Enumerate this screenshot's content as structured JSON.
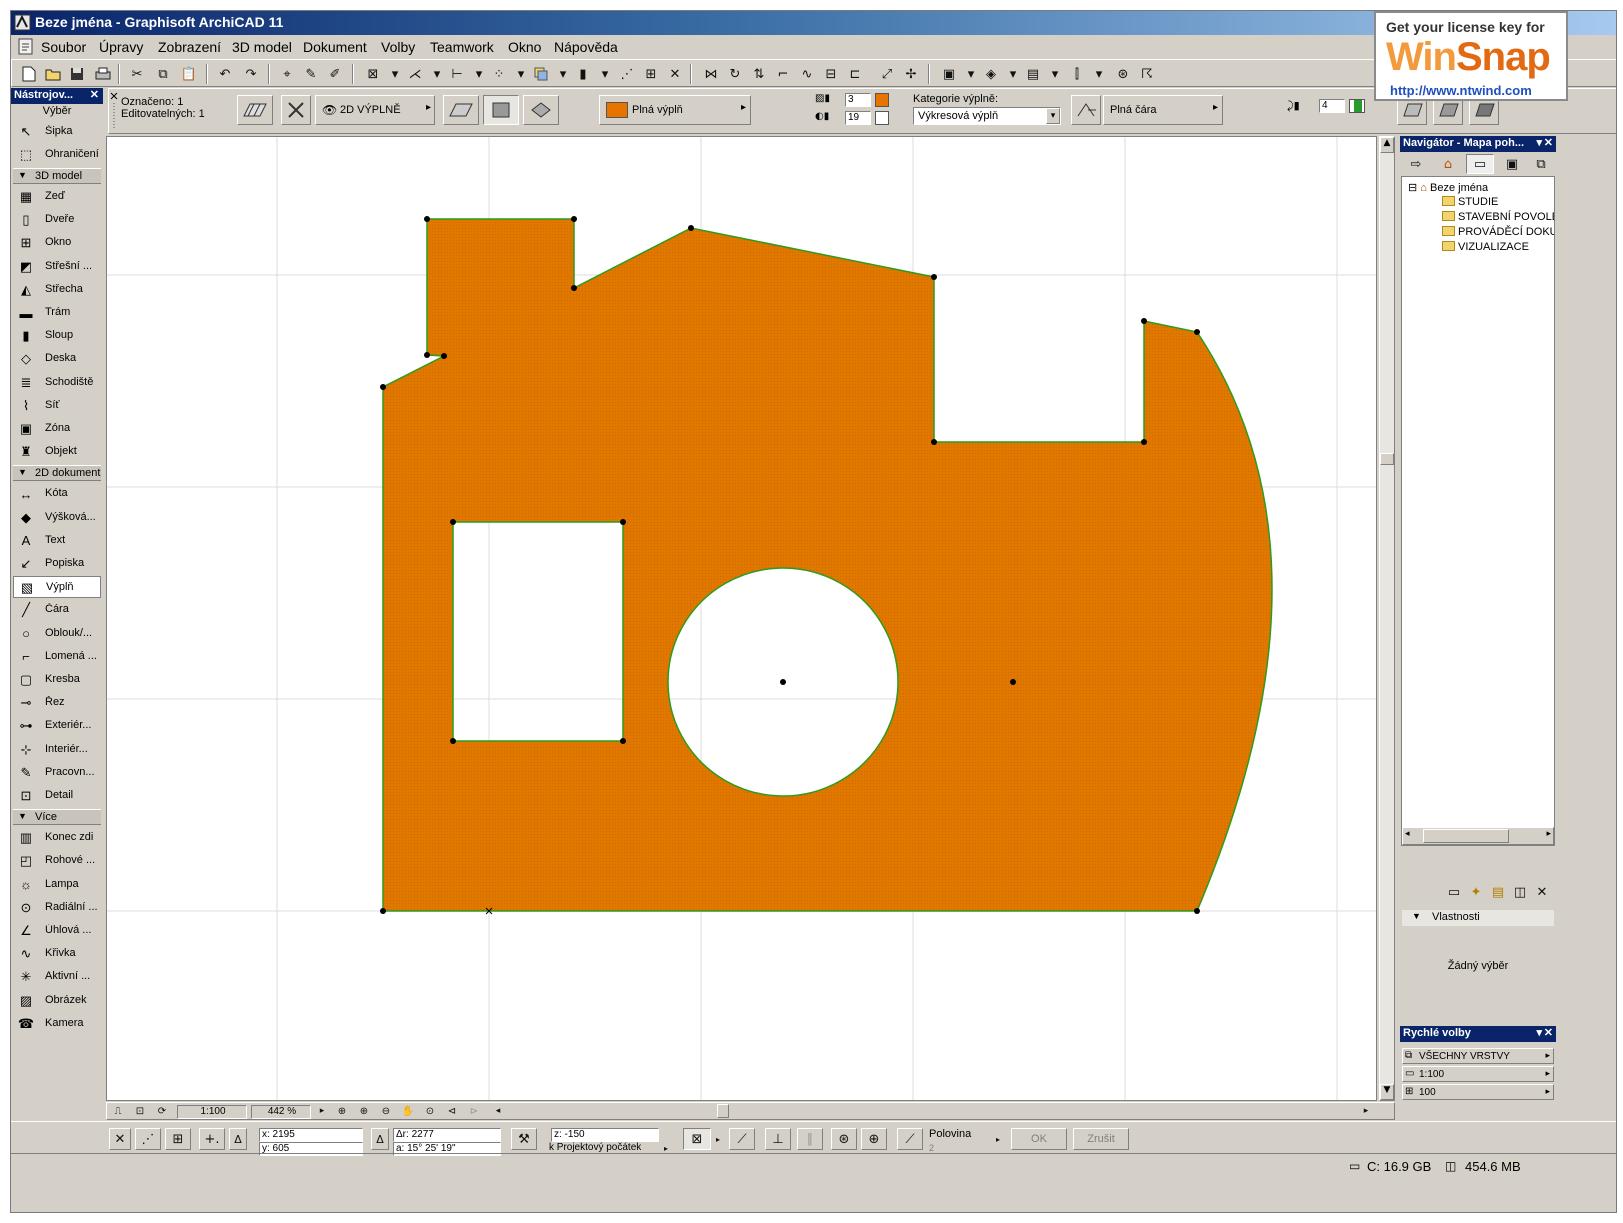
{
  "window": {
    "title": "Beze jména - Graphisoft ArchiCAD 11"
  },
  "ad": {
    "line1": "Get your license key for",
    "brand_a": "Win",
    "brand_b": "Snap",
    "url": "http://www.ntwind.com"
  },
  "menu": [
    "Soubor",
    "Úpravy",
    "Zobrazení",
    "3D model",
    "Dokument",
    "Volby",
    "Teamwork",
    "Okno",
    "Nápověda"
  ],
  "infobox": {
    "selected": "Označeno: 1",
    "editable": "Editovatelných: 1",
    "mode": "2D VÝPLNĚ",
    "fill_name": "Plná výplň",
    "pen1": "3",
    "pen2": "19",
    "category_label": "Kategorie výplně:",
    "category_value": "Výkresová výplň",
    "line_type": "Plná čára",
    "pen_right": "4",
    "fill_color": "#e87400"
  },
  "toolbox": {
    "title": "Nástrojov...",
    "select_group": "Výběr",
    "groups": {
      "model": "3D model",
      "document": "2D dokument",
      "more": "Více"
    },
    "select_tools": [
      {
        "label": "Šipka",
        "icon": "arrow-icon"
      },
      {
        "label": "Ohraničení",
        "icon": "marquee-icon"
      }
    ],
    "model_tools": [
      {
        "label": "Zeď",
        "icon": "wall-icon"
      },
      {
        "label": "Dveře",
        "icon": "door-icon"
      },
      {
        "label": "Okno",
        "icon": "window-icon"
      },
      {
        "label": "Střešní ...",
        "icon": "roof-window-icon"
      },
      {
        "label": "Střecha",
        "icon": "roof-icon"
      },
      {
        "label": "Trám",
        "icon": "beam-icon"
      },
      {
        "label": "Sloup",
        "icon": "column-icon"
      },
      {
        "label": "Deska",
        "icon": "slab-icon"
      },
      {
        "label": "Schodiště",
        "icon": "stair-icon"
      },
      {
        "label": "Síť",
        "icon": "mesh-icon"
      },
      {
        "label": "Zóna",
        "icon": "zone-icon"
      },
      {
        "label": "Objekt",
        "icon": "object-icon"
      }
    ],
    "document_tools": [
      {
        "label": "Kóta",
        "icon": "dimension-icon"
      },
      {
        "label": "Výšková...",
        "icon": "level-dimension-icon"
      },
      {
        "label": "Text",
        "icon": "text-icon"
      },
      {
        "label": "Popiska",
        "icon": "label-icon"
      },
      {
        "label": "Výplň",
        "icon": "fill-icon"
      },
      {
        "label": "Čára",
        "icon": "line-icon"
      },
      {
        "label": "Oblouk/...",
        "icon": "arc-icon"
      },
      {
        "label": "Lomená ...",
        "icon": "polyline-icon"
      },
      {
        "label": "Kresba",
        "icon": "drawing-icon"
      },
      {
        "label": "Řez",
        "icon": "section-icon"
      },
      {
        "label": "Exteriér...",
        "icon": "elevation-icon"
      },
      {
        "label": "Interiér...",
        "icon": "interior-elevation-icon"
      },
      {
        "label": "Pracovn...",
        "icon": "worksheet-icon"
      },
      {
        "label": "Detail",
        "icon": "detail-icon"
      }
    ],
    "more_tools": [
      {
        "label": "Konec zdi",
        "icon": "wall-end-icon"
      },
      {
        "label": "Rohové ...",
        "icon": "corner-window-icon"
      },
      {
        "label": "Lampa",
        "icon": "lamp-icon"
      },
      {
        "label": "Radiální ...",
        "icon": "radial-dimension-icon"
      },
      {
        "label": "Úhlová ...",
        "icon": "angle-dimension-icon"
      },
      {
        "label": "Křivka",
        "icon": "spline-icon"
      },
      {
        "label": "Aktivní ...",
        "icon": "hotspot-icon"
      },
      {
        "label": "Obrázek",
        "icon": "figure-icon"
      },
      {
        "label": "Kamera",
        "icon": "camera-icon"
      }
    ],
    "selected_tool": "Výplň"
  },
  "canvas": {
    "fill_color": "#e07400",
    "outline_color": "#2e9a1e"
  },
  "navigator": {
    "title": "Navigátor - Mapa poh...",
    "root": "Beze jména",
    "items": [
      "STUDIE",
      "STAVEBNÍ POVOLEN",
      "PROVÁDĚCÍ DOKUM",
      "VIZUALIZACE"
    ],
    "properties_label": "Vlastnosti",
    "no_selection": "Žádný výběr"
  },
  "quick_options": {
    "title": "Rychlé volby",
    "layers": "VŠECHNY VRSTVY",
    "scale": "1:100",
    "pen_set": "100"
  },
  "hbar": {
    "scale": "1:100",
    "zoom": "442 %"
  },
  "coords": {
    "x": "x: 2195",
    "y": "y: 605",
    "dr": "Δr: 2277",
    "a": "a: 15° 25' 19\"",
    "z": "z: -150",
    "origin": "k Projektový počátek",
    "snap": "Polovina",
    "snap_sub": "2",
    "ok": "OK",
    "cancel": "Zrušit"
  },
  "status": {
    "disk": "C: 16.9 GB",
    "memory": "454.6 MB"
  }
}
